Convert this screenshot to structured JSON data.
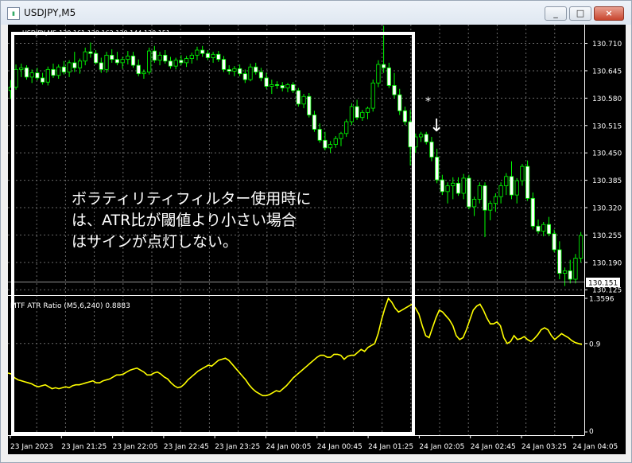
{
  "window": {
    "title": "USDJPY,M5",
    "minimize": "_",
    "maximize": "□",
    "close": "×"
  },
  "chart_data": [
    {
      "type": "candlestick",
      "title": "USDJPY,M5 130.161 130.162 130.144 130.151",
      "symbol": "USDJPY,M5",
      "y_ticks": [
        130.71,
        130.645,
        130.58,
        130.515,
        130.45,
        130.385,
        130.32,
        130.255,
        130.19,
        130.125
      ],
      "ylim": [
        130.116,
        130.745
      ],
      "current_price": 130.151,
      "grid": "dotted",
      "colors": {
        "bull": "#00ff00",
        "bear_body": "#ffffff",
        "background": "#000000"
      },
      "annotation_marker": "*",
      "annotation_arrow": "↓",
      "candles": [
        [
          130.598,
          130.623,
          130.578,
          130.606
        ],
        [
          130.606,
          130.66,
          130.6,
          130.648
        ],
        [
          130.648,
          130.662,
          130.63,
          130.652
        ],
        [
          130.652,
          130.658,
          130.624,
          130.63
        ],
        [
          130.63,
          130.648,
          130.616,
          130.64
        ],
        [
          130.64,
          130.652,
          130.622,
          130.628
        ],
        [
          130.628,
          130.64,
          130.612,
          130.618
        ],
        [
          130.618,
          130.655,
          130.61,
          130.648
        ],
        [
          130.648,
          130.662,
          130.628,
          130.634
        ],
        [
          130.634,
          130.66,
          130.626,
          130.654
        ],
        [
          130.654,
          130.668,
          130.636,
          130.642
        ],
        [
          130.642,
          130.67,
          130.63,
          130.664
        ],
        [
          130.664,
          130.69,
          130.642,
          130.652
        ],
        [
          130.652,
          130.674,
          130.638,
          130.668
        ],
        [
          130.668,
          130.7,
          130.658,
          130.69
        ],
        [
          130.69,
          130.712,
          130.676,
          130.686
        ],
        [
          130.686,
          130.694,
          130.66,
          130.664
        ],
        [
          130.664,
          130.676,
          130.64,
          130.648
        ],
        [
          130.648,
          130.69,
          130.64,
          130.682
        ],
        [
          130.682,
          130.696,
          130.664,
          130.672
        ],
        [
          130.672,
          130.69,
          130.658,
          130.664
        ],
        [
          130.664,
          130.678,
          130.65,
          130.672
        ],
        [
          130.672,
          130.692,
          130.66,
          130.68
        ],
        [
          130.68,
          130.69,
          130.652,
          130.658
        ],
        [
          130.658,
          130.672,
          130.632,
          130.638
        ],
        [
          130.638,
          130.648,
          130.626,
          130.642
        ],
        [
          130.642,
          130.7,
          130.636,
          130.692
        ],
        [
          130.692,
          130.704,
          130.664,
          130.67
        ],
        [
          130.67,
          130.69,
          130.658,
          130.682
        ],
        [
          130.682,
          130.694,
          130.662,
          130.668
        ],
        [
          130.668,
          130.678,
          130.65,
          130.656
        ],
        [
          130.656,
          130.676,
          130.648,
          130.67
        ],
        [
          130.67,
          130.682,
          130.658,
          130.664
        ],
        [
          130.664,
          130.68,
          130.654,
          130.674
        ],
        [
          130.674,
          130.688,
          130.662,
          130.682
        ],
        [
          130.682,
          130.702,
          130.67,
          130.694
        ],
        [
          130.694,
          130.704,
          130.678,
          130.686
        ],
        [
          130.686,
          130.694,
          130.67,
          130.676
        ],
        [
          130.676,
          130.69,
          130.664,
          130.684
        ],
        [
          130.684,
          130.692,
          130.666,
          130.672
        ],
        [
          130.672,
          130.68,
          130.642,
          130.648
        ],
        [
          130.648,
          130.658,
          130.636,
          130.644
        ],
        [
          130.644,
          130.656,
          130.632,
          130.65
        ],
        [
          130.65,
          130.66,
          130.632,
          130.638
        ],
        [
          130.638,
          130.648,
          130.616,
          130.624
        ],
        [
          130.624,
          130.662,
          130.62,
          130.654
        ],
        [
          130.654,
          130.664,
          130.636,
          130.642
        ],
        [
          130.642,
          130.652,
          130.62,
          130.628
        ],
        [
          130.628,
          130.64,
          130.602,
          130.608
        ],
        [
          130.608,
          130.624,
          130.59,
          130.612
        ],
        [
          130.612,
          130.62,
          130.602,
          130.61
        ],
        [
          130.61,
          130.618,
          130.596,
          130.604
        ],
        [
          130.604,
          130.616,
          130.594,
          130.612
        ],
        [
          130.612,
          130.618,
          130.592,
          130.598
        ],
        [
          130.598,
          130.604,
          130.56,
          130.566
        ],
        [
          130.566,
          130.59,
          130.556,
          130.584
        ],
        [
          130.584,
          130.592,
          130.534,
          130.54
        ],
        [
          130.54,
          130.55,
          130.5,
          130.506
        ],
        [
          130.506,
          130.52,
          130.474,
          130.48
        ],
        [
          130.48,
          130.5,
          130.456,
          130.462
        ],
        [
          130.462,
          130.478,
          130.45,
          130.47
        ],
        [
          130.47,
          130.49,
          130.462,
          130.484
        ],
        [
          130.484,
          130.5,
          130.466,
          130.496
        ],
        [
          130.496,
          130.53,
          130.488,
          130.524
        ],
        [
          130.524,
          130.568,
          130.516,
          130.56
        ],
        [
          130.56,
          130.576,
          130.528,
          130.534
        ],
        [
          130.534,
          130.552,
          130.526,
          130.546
        ],
        [
          130.546,
          130.56,
          130.53,
          130.556
        ],
        [
          130.556,
          130.624,
          130.548,
          130.616
        ],
        [
          130.616,
          130.67,
          130.606,
          130.66
        ],
        [
          130.66,
          130.752,
          130.64,
          130.652
        ],
        [
          130.652,
          130.664,
          130.604,
          130.61
        ],
        [
          130.61,
          130.64,
          130.58,
          130.588
        ],
        [
          130.588,
          130.602,
          130.54,
          130.55
        ],
        [
          130.55,
          130.56,
          130.516,
          130.524
        ],
        [
          130.524,
          130.552,
          130.42,
          130.464
        ],
        [
          130.464,
          130.496,
          130.45,
          130.488
        ],
        [
          130.488,
          130.5,
          130.476,
          130.494
        ],
        [
          130.494,
          130.5,
          130.47,
          130.476
        ],
        [
          130.476,
          130.488,
          130.43,
          130.44
        ],
        [
          130.44,
          130.46,
          130.378,
          130.386
        ],
        [
          130.386,
          130.398,
          130.35,
          130.358
        ],
        [
          130.358,
          130.38,
          130.33,
          130.372
        ],
        [
          130.372,
          130.392,
          130.34,
          130.378
        ],
        [
          130.378,
          130.392,
          130.348,
          130.354
        ],
        [
          130.354,
          130.4,
          130.34,
          130.39
        ],
        [
          130.39,
          130.398,
          130.316,
          130.322
        ],
        [
          130.322,
          130.346,
          130.3,
          130.34
        ],
        [
          130.34,
          130.38,
          130.33,
          130.372
        ],
        [
          130.372,
          130.38,
          130.25,
          130.314
        ],
        [
          130.314,
          130.336,
          130.29,
          130.33
        ],
        [
          130.33,
          130.354,
          130.31,
          130.346
        ],
        [
          130.346,
          130.38,
          130.33,
          130.372
        ],
        [
          130.372,
          130.402,
          130.35,
          130.394
        ],
        [
          130.394,
          130.43,
          130.34,
          130.35
        ],
        [
          130.35,
          130.39,
          130.33,
          130.384
        ],
        [
          130.384,
          130.424,
          130.372,
          130.418
        ],
        [
          130.418,
          130.432,
          130.336,
          130.342
        ],
        [
          130.342,
          130.356,
          130.268,
          130.276
        ],
        [
          130.276,
          130.292,
          130.258,
          130.264
        ],
        [
          130.264,
          130.286,
          130.252,
          130.28
        ],
        [
          130.28,
          130.298,
          130.252,
          130.258
        ],
        [
          130.258,
          130.268,
          130.214,
          130.22
        ],
        [
          130.22,
          130.24,
          130.15,
          130.164
        ],
        [
          130.164,
          130.178,
          130.134,
          130.17
        ],
        [
          130.17,
          130.196,
          130.14,
          130.15
        ],
        [
          130.15,
          130.21,
          130.14,
          130.2
        ],
        [
          130.2,
          130.262,
          130.19,
          130.254
        ]
      ]
    },
    {
      "type": "line",
      "title": "MTF ATR Ratio  (M5,6,240) 0.8883",
      "y_ticks": [
        {
          "value": 1.3596,
          "label": "1.3596"
        },
        {
          "value": 0.9,
          "label": "0.9"
        },
        {
          "value": 0,
          "label": "0"
        }
      ],
      "ylim": [
        0,
        1.3596
      ],
      "series": [
        {
          "color": "#ffff00",
          "values": [
            0.6,
            0.59,
            0.55,
            0.53,
            0.52,
            0.51,
            0.5,
            0.49,
            0.47,
            0.46,
            0.47,
            0.48,
            0.46,
            0.44,
            0.45,
            0.44,
            0.45,
            0.46,
            0.45,
            0.47,
            0.48,
            0.48,
            0.49,
            0.5,
            0.51,
            0.52,
            0.5,
            0.5,
            0.52,
            0.53,
            0.54,
            0.56,
            0.58,
            0.58,
            0.59,
            0.61,
            0.63,
            0.64,
            0.65,
            0.63,
            0.61,
            0.58,
            0.58,
            0.6,
            0.61,
            0.59,
            0.56,
            0.54,
            0.5,
            0.47,
            0.45,
            0.46,
            0.49,
            0.53,
            0.56,
            0.59,
            0.62,
            0.64,
            0.66,
            0.68,
            0.67,
            0.7,
            0.73,
            0.74,
            0.75,
            0.73,
            0.69,
            0.65,
            0.61,
            0.57,
            0.53,
            0.48,
            0.44,
            0.41,
            0.39,
            0.37,
            0.37,
            0.38,
            0.4,
            0.42,
            0.41,
            0.44,
            0.47,
            0.51,
            0.55,
            0.58,
            0.61,
            0.64,
            0.67,
            0.7,
            0.73,
            0.76,
            0.78,
            0.78,
            0.76,
            0.76,
            0.79,
            0.79,
            0.78,
            0.74,
            0.77,
            0.78,
            0.78,
            0.81,
            0.84,
            0.82,
            0.86,
            0.88,
            0.9,
            1.0,
            1.14,
            1.26,
            1.36,
            1.32,
            1.26,
            1.22,
            1.24,
            1.26,
            1.28,
            1.3,
            1.26,
            1.2,
            1.08,
            0.98,
            0.96,
            1.06,
            1.16,
            1.24,
            1.22,
            1.18,
            1.14,
            1.08,
            0.98,
            0.94,
            0.96,
            1.04,
            1.14,
            1.24,
            1.28,
            1.3,
            1.24,
            1.16,
            1.1,
            1.1,
            1.12,
            1.08,
            0.96,
            0.9,
            0.92,
            0.98,
            0.94,
            0.95,
            0.97,
            0.94,
            0.92,
            0.95,
            0.99,
            1.04,
            1.06,
            1.04,
            0.98,
            0.94,
            0.97,
            1.0,
            0.98,
            0.96,
            0.93,
            0.91,
            0.9,
            0.89
          ]
        }
      ]
    }
  ],
  "x_labels": [
    "23 Jan 2023",
    "23 Jan 21:25",
    "23 Jan 22:05",
    "23 Jan 22:45",
    "23 Jan 23:25",
    "24 Jan 00:05",
    "24 Jan 00:45",
    "24 Jan 01:25",
    "24 Jan 02:05",
    "24 Jan 02:45",
    "24 Jan 03:25",
    "24 Jan 04:05"
  ],
  "note_text": "ボラティリティフィルター使用時に\nは、ATR比が閾値より小さい場合\nはサインが点灯しない。"
}
